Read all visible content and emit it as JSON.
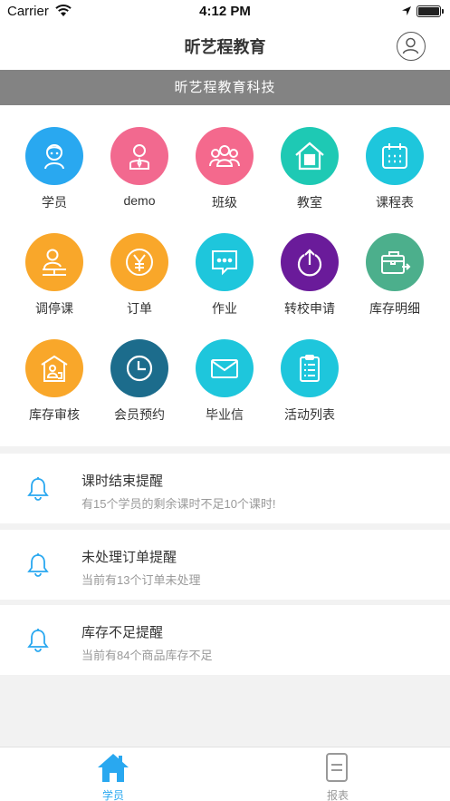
{
  "status_bar": {
    "carrier": "Carrier",
    "time": "4:12 PM"
  },
  "nav": {
    "title": "昕艺程教育",
    "profile_icon": "user-circle-icon"
  },
  "banner": {
    "text": "昕艺程教育科技"
  },
  "menu": [
    {
      "label": "学员",
      "color": "#29a8f0",
      "icon": "student-icon"
    },
    {
      "label": "demo",
      "color": "#f2698f",
      "icon": "person-tie-icon"
    },
    {
      "label": "班级",
      "color": "#f4698d",
      "icon": "group-icon"
    },
    {
      "label": "教室",
      "color": "#1ec9b4",
      "icon": "house-icon"
    },
    {
      "label": "课程表",
      "color": "#1ec6dc",
      "icon": "calendar-icon"
    },
    {
      "label": "调停课",
      "color": "#f9a72a",
      "icon": "person-desk-icon"
    },
    {
      "label": "订单",
      "color": "#f9a72a",
      "icon": "yen-icon"
    },
    {
      "label": "作业",
      "color": "#1ec6dc",
      "icon": "message-dots-icon"
    },
    {
      "label": "转校申请",
      "color": "#6a1b9a",
      "icon": "power-arrow-icon"
    },
    {
      "label": "库存明细",
      "color": "#4caf8c",
      "icon": "briefcase-icon"
    },
    {
      "label": "库存审核",
      "color": "#f9a72a",
      "icon": "warehouse-icon"
    },
    {
      "label": "会员预约",
      "color": "#1c6c8c",
      "icon": "clock-icon"
    },
    {
      "label": "毕业信",
      "color": "#1ec6dc",
      "icon": "envelope-icon"
    },
    {
      "label": "活动列表",
      "color": "#1ec6dc",
      "icon": "clipboard-list-icon"
    }
  ],
  "reminders": [
    {
      "title": "课时结束提醒",
      "desc": "有15个学员的剩余课时不足10个课时!",
      "icon": "bell-icon"
    },
    {
      "title": "未处理订单提醒",
      "desc": "当前有13个订单未处理",
      "icon": "bell-icon"
    },
    {
      "title": "库存不足提醒",
      "desc": "当前有84个商品库存不足",
      "icon": "bell-icon"
    }
  ],
  "tabbar": {
    "active_color": "#29a8f0",
    "inactive_color": "#999999",
    "items": [
      {
        "label": "学员",
        "icon": "home-icon",
        "active": true
      },
      {
        "label": "报表",
        "icon": "document-icon",
        "active": false
      }
    ]
  }
}
